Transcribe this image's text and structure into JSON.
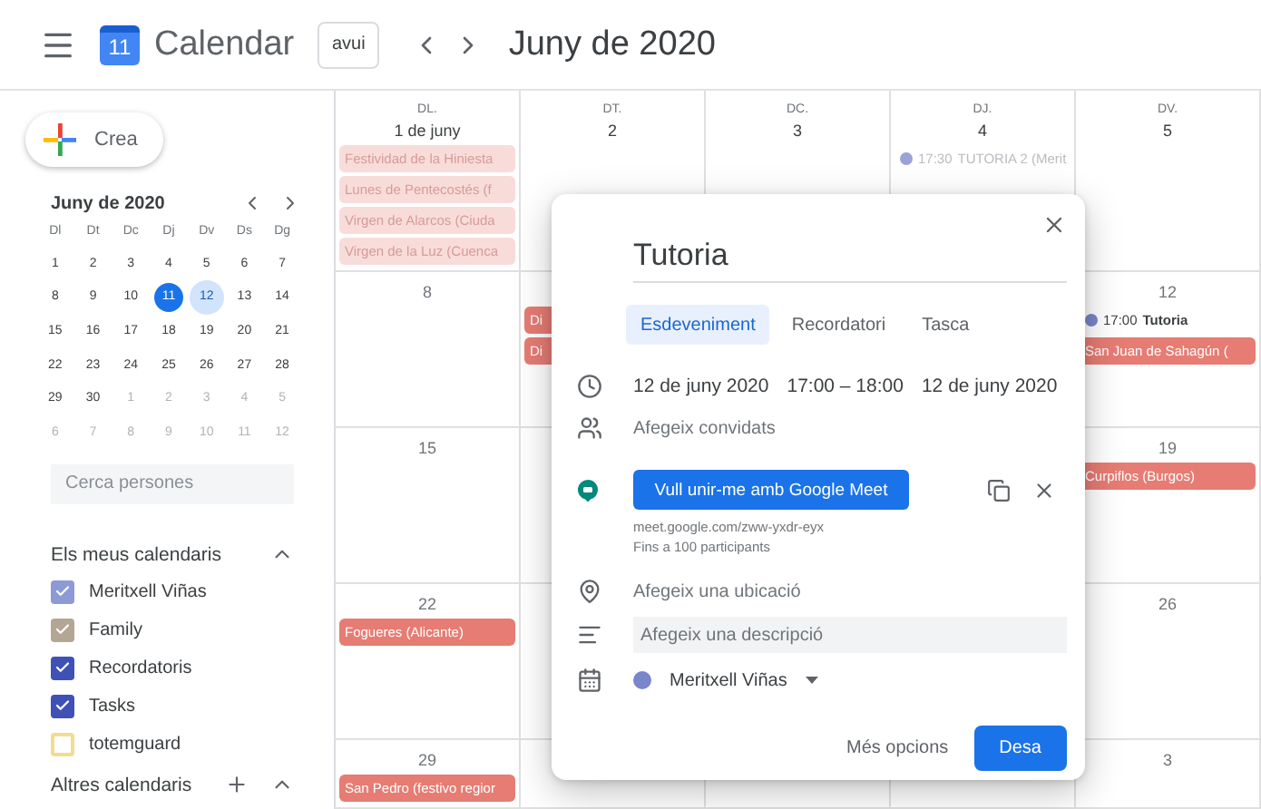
{
  "header": {
    "logo_day": "11",
    "app_name": "Calendar",
    "today_button": "avui",
    "period": "Juny de 2020"
  },
  "sidebar": {
    "create_button": "Crea",
    "mini_calendar": {
      "title": "Juny de 2020",
      "weekdays": [
        "Dl",
        "Dt",
        "Dc",
        "Dj",
        "Dv",
        "Ds",
        "Dg"
      ],
      "weeks": [
        [
          {
            "label": "1",
            "muted": false,
            "today": false,
            "selected": false
          },
          {
            "label": "2",
            "muted": false,
            "today": false,
            "selected": false
          },
          {
            "label": "3",
            "muted": false,
            "today": false,
            "selected": false
          },
          {
            "label": "4",
            "muted": false,
            "today": false,
            "selected": false
          },
          {
            "label": "5",
            "muted": false,
            "today": false,
            "selected": false
          },
          {
            "label": "6",
            "muted": false,
            "today": false,
            "selected": false
          },
          {
            "label": "7",
            "muted": false,
            "today": false,
            "selected": false
          }
        ],
        [
          {
            "label": "8",
            "muted": false,
            "today": false,
            "selected": false
          },
          {
            "label": "9",
            "muted": false,
            "today": false,
            "selected": false
          },
          {
            "label": "10",
            "muted": false,
            "today": false,
            "selected": false
          },
          {
            "label": "11",
            "muted": false,
            "today": true,
            "selected": false
          },
          {
            "label": "12",
            "muted": false,
            "today": false,
            "selected": true
          },
          {
            "label": "13",
            "muted": false,
            "today": false,
            "selected": false
          },
          {
            "label": "14",
            "muted": false,
            "today": false,
            "selected": false
          }
        ],
        [
          {
            "label": "15",
            "muted": false,
            "today": false,
            "selected": false
          },
          {
            "label": "16",
            "muted": false,
            "today": false,
            "selected": false
          },
          {
            "label": "17",
            "muted": false,
            "today": false,
            "selected": false
          },
          {
            "label": "18",
            "muted": false,
            "today": false,
            "selected": false
          },
          {
            "label": "19",
            "muted": false,
            "today": false,
            "selected": false
          },
          {
            "label": "20",
            "muted": false,
            "today": false,
            "selected": false
          },
          {
            "label": "21",
            "muted": false,
            "today": false,
            "selected": false
          }
        ],
        [
          {
            "label": "22",
            "muted": false,
            "today": false,
            "selected": false
          },
          {
            "label": "23",
            "muted": false,
            "today": false,
            "selected": false
          },
          {
            "label": "24",
            "muted": false,
            "today": false,
            "selected": false
          },
          {
            "label": "25",
            "muted": false,
            "today": false,
            "selected": false
          },
          {
            "label": "26",
            "muted": false,
            "today": false,
            "selected": false
          },
          {
            "label": "27",
            "muted": false,
            "today": false,
            "selected": false
          },
          {
            "label": "28",
            "muted": false,
            "today": false,
            "selected": false
          }
        ],
        [
          {
            "label": "29",
            "muted": false,
            "today": false,
            "selected": false
          },
          {
            "label": "30",
            "muted": false,
            "today": false,
            "selected": false
          },
          {
            "label": "1",
            "muted": true,
            "today": false,
            "selected": false
          },
          {
            "label": "2",
            "muted": true,
            "today": false,
            "selected": false
          },
          {
            "label": "3",
            "muted": true,
            "today": false,
            "selected": false
          },
          {
            "label": "4",
            "muted": true,
            "today": false,
            "selected": false
          },
          {
            "label": "5",
            "muted": true,
            "today": false,
            "selected": false
          }
        ],
        [
          {
            "label": "6",
            "muted": true,
            "today": false,
            "selected": false
          },
          {
            "label": "7",
            "muted": true,
            "today": false,
            "selected": false
          },
          {
            "label": "8",
            "muted": true,
            "today": false,
            "selected": false
          },
          {
            "label": "9",
            "muted": true,
            "today": false,
            "selected": false
          },
          {
            "label": "10",
            "muted": true,
            "today": false,
            "selected": false
          },
          {
            "label": "11",
            "muted": true,
            "today": false,
            "selected": false
          },
          {
            "label": "12",
            "muted": true,
            "today": false,
            "selected": false
          }
        ]
      ]
    },
    "search": {
      "placeholder": "Cerca persones"
    },
    "my_calendars": {
      "title": "Els meus calendaris",
      "expanded": true,
      "items": [
        {
          "label": "Meritxell Viñas",
          "checked": true,
          "color": "#8e9ad6"
        },
        {
          "label": "Family",
          "checked": true,
          "color": "#b4a695"
        },
        {
          "label": "Recordatoris",
          "checked": true,
          "color": "#3f51b5"
        },
        {
          "label": "Tasks",
          "checked": true,
          "color": "#3f51b5"
        },
        {
          "label": "totemguard",
          "checked": false,
          "color": "#f2dd8f"
        }
      ]
    },
    "other_calendars": {
      "title": "Altres calendaris",
      "expanded": true
    }
  },
  "calendar": {
    "columns": [
      {
        "weekday": "DL.",
        "date": "1 de juny",
        "events": [
          {
            "kind": "holiday",
            "title": "Festividad de la Hiniesta",
            "past": true
          },
          {
            "kind": "holiday",
            "title": "Lunes de Pentecostés (f",
            "past": true
          },
          {
            "kind": "holiday",
            "title": "Virgen de Alarcos (Ciuda",
            "past": true
          },
          {
            "kind": "holiday",
            "title": "Virgen de la Luz (Cuenca",
            "past": true
          }
        ]
      },
      {
        "weekday": "DT.",
        "date": "2"
      },
      {
        "weekday": "DC.",
        "date": "3"
      },
      {
        "weekday": "DJ.",
        "date": "4",
        "events": [
          {
            "kind": "timed",
            "time": "17:30",
            "title": "TUTORIA 2 (Merit",
            "color": "#9aa3d6",
            "past": true
          }
        ]
      },
      {
        "weekday": "DV.",
        "date": "5"
      }
    ],
    "weeks": [
      {
        "cells": [
          {
            "day": "8"
          },
          {
            "events": [
              {
                "kind": "holiday",
                "title": "Di",
                "past": false
              },
              {
                "kind": "holiday",
                "title": "Di",
                "past": false
              }
            ]
          },
          {},
          {},
          {
            "day": "12",
            "events": [
              {
                "kind": "timed",
                "time": "17:00",
                "title": "Tutoria",
                "color": "#7986cb",
                "past": false
              },
              {
                "kind": "holiday",
                "title": "San Juan de Sahagún (",
                "past": false
              }
            ]
          }
        ]
      },
      {
        "cells": [
          {
            "day": "15"
          },
          {},
          {},
          {},
          {
            "day": "19",
            "events": [
              {
                "kind": "holiday",
                "title": "Curpiflos (Burgos)",
                "past": false
              }
            ]
          }
        ]
      },
      {
        "cells": [
          {
            "day": "22",
            "events": [
              {
                "kind": "holiday",
                "title": "Fogueres (Alicante)",
                "past": false
              }
            ]
          },
          {},
          {},
          {},
          {
            "day": "26"
          }
        ]
      },
      {
        "cells": [
          {
            "day": "29",
            "events": [
              {
                "kind": "holiday",
                "title": "San Pedro (festivo regior",
                "past": false
              }
            ]
          },
          {},
          {},
          {},
          {
            "day": "3"
          }
        ]
      }
    ]
  },
  "dialog": {
    "title": "Tutoria",
    "tabs": [
      {
        "label": "Esdeveniment",
        "selected": true
      },
      {
        "label": "Recordatori",
        "selected": false
      },
      {
        "label": "Tasca",
        "selected": false
      }
    ],
    "start_date": "12 de juny 2020",
    "time_range": "17:00 – 18:00",
    "end_date": "12 de juny 2020",
    "guests": {
      "placeholder": "Afegeix convidats"
    },
    "meet_button": "Vull unir-me amb Google Meet",
    "meet_link": "meet.google.com/zww-yxdr-eyx",
    "meet_note": "Fins a 100 participants",
    "location": {
      "placeholder": "Afegeix una ubicació"
    },
    "description": {
      "placeholder": "Afegeix una descripció"
    },
    "calendar": {
      "name": "Meritxell Viñas",
      "color": "#7986cb"
    },
    "more_options": "Més opcions",
    "save": "Desa"
  }
}
